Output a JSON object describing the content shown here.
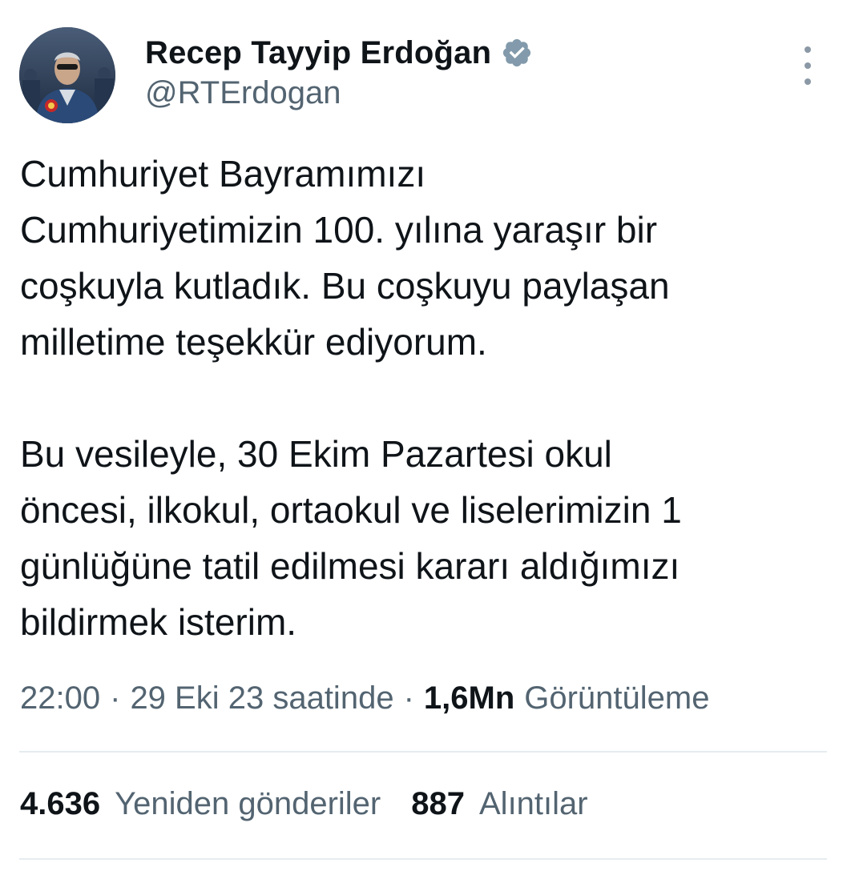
{
  "author": {
    "display_name": "Recep Tayyip Erdoğan",
    "handle": "@RTErdogan",
    "verified_icon": "verified-badge-icon",
    "avatar_icon": "avatar-photo"
  },
  "header": {
    "more_icon": "more-options-icon"
  },
  "tweet": {
    "lines": [
      "Cumhuriyet Bayramımızı",
      "Cumhuriyetimizin 100. yılına yaraşır bir",
      "coşkuyla kutladık. Bu coşkuyu paylaşan",
      "milletime teşekkür ediyorum.",
      "Bu vesileyle, 30 Ekim Pazartesi okul",
      "öncesi, ilkokul, ortaokul ve liselerimizin 1",
      "günlüğüne tatil edilmesi kararı aldığımızı",
      "bildirmek isterim."
    ]
  },
  "meta": {
    "time": "22:00",
    "separator": "·",
    "date": "29 Eki 23 saatinde",
    "views_count": "1,6Mn",
    "views_label": "Görüntüleme"
  },
  "stats": {
    "retweets_count": "4.636",
    "retweets_label": "Yeniden gönderiler",
    "quotes_count": "887",
    "quotes_label": "Alıntılar"
  },
  "colors": {
    "text_primary": "#0f1419",
    "text_secondary": "#536471",
    "verified": "#829aab",
    "divider": "#e6ecf0"
  }
}
